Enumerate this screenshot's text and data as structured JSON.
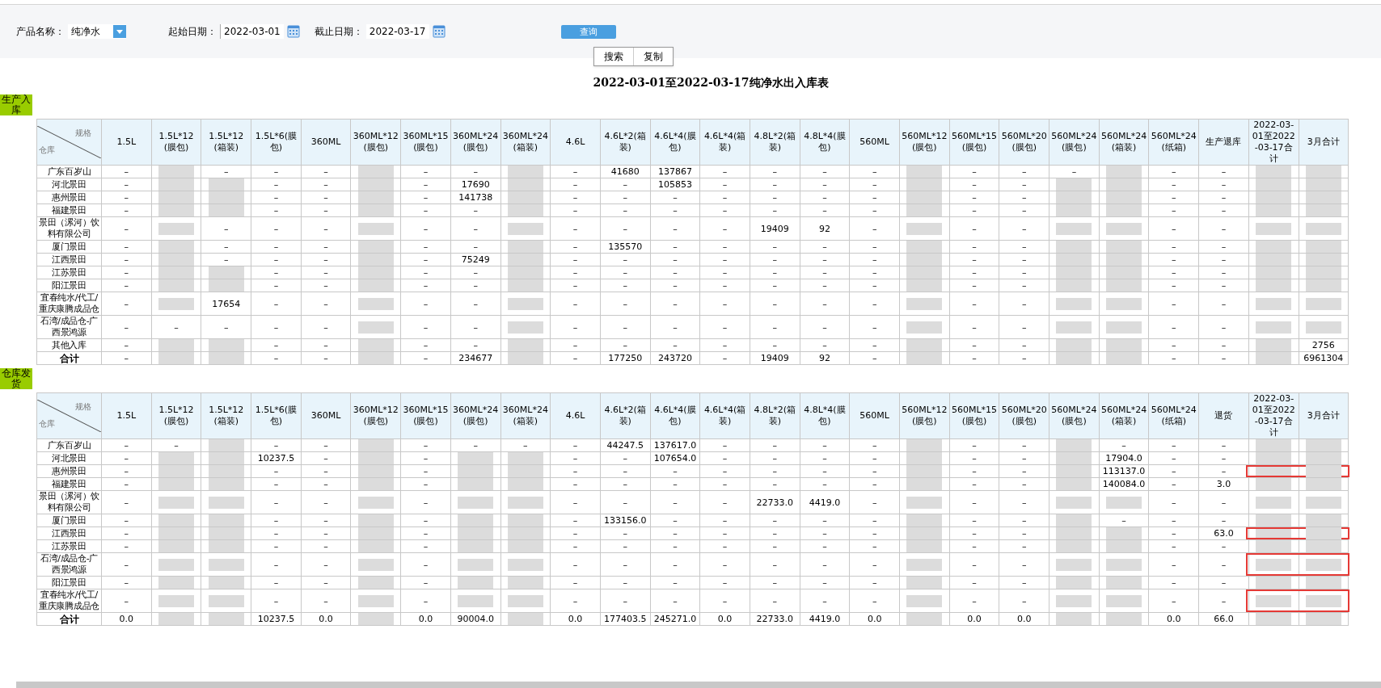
{
  "filters": {
    "product_label": "产品名称：",
    "product_value": "纯净水",
    "start_label": "起始日期：",
    "start_value": "2022-03-01",
    "end_label": "截止日期：",
    "end_value": "2022-03-17",
    "query_button": "查询"
  },
  "toolbar": [
    "搜索",
    "复制"
  ],
  "report_title": "2022-03-01至2022-03-17纯净水出入库表",
  "sections": [
    {
      "tag": "生产入库",
      "corner_top": "规格",
      "corner_bottom": "仓库",
      "columns": [
        "1.5L",
        "1.5L*12(膜包)",
        "1.5L*12(箱装)",
        "1.5L*6(膜包)",
        "360ML",
        "360ML*12(膜包)",
        "360ML*15(膜包)",
        "360ML*24(膜包)",
        "360ML*24(箱装)",
        "4.6L",
        "4.6L*2(箱装)",
        "4.6L*4(膜包)",
        "4.6L*4(箱装)",
        "4.8L*2(箱装)",
        "4.8L*4(膜包)",
        "560ML",
        "560ML*12(膜包)",
        "560ML*15(膜包)",
        "560ML*20(膜包)",
        "560ML*24(膜包)",
        "560ML*24(箱装)",
        "560ML*24(纸箱)",
        "生产退库",
        "2022-03-01至2022-03-17合计",
        "3月合计"
      ],
      "rows": [
        {
          "name": "广东百岁山",
          "kind": "item",
          "flagged": false,
          "cells": [
            "–",
            null,
            "–",
            "–",
            "–",
            null,
            "–",
            "–",
            null,
            "–",
            "41680",
            "137867",
            "–",
            "–",
            "–",
            "–",
            null,
            "–",
            "–",
            "–",
            null,
            "–",
            "–",
            null,
            null
          ]
        },
        {
          "name": "河北景田",
          "kind": "item",
          "flagged": false,
          "cells": [
            "–",
            null,
            null,
            "–",
            "–",
            null,
            "–",
            "17690",
            null,
            "–",
            "–",
            "105853",
            "–",
            "–",
            "–",
            "–",
            null,
            "–",
            "–",
            null,
            null,
            "–",
            "–",
            null,
            null
          ]
        },
        {
          "name": "惠州景田",
          "kind": "item",
          "flagged": false,
          "cells": [
            "–",
            null,
            null,
            "–",
            "–",
            null,
            "–",
            "141738",
            null,
            "–",
            "–",
            "–",
            "–",
            "–",
            "–",
            "–",
            null,
            "–",
            "–",
            null,
            null,
            "–",
            "–",
            null,
            null
          ]
        },
        {
          "name": "福建景田",
          "kind": "item",
          "flagged": false,
          "cells": [
            "–",
            null,
            null,
            "–",
            "–",
            null,
            "–",
            "–",
            null,
            "–",
            "–",
            "–",
            "–",
            "–",
            "–",
            "–",
            null,
            "–",
            "–",
            null,
            null,
            "–",
            "–",
            null,
            null
          ]
        },
        {
          "name": "景田（漯河）饮料有限公司",
          "kind": "item",
          "flagged": false,
          "cells": [
            "–",
            null,
            "–",
            "–",
            "–",
            null,
            "–",
            "–",
            null,
            "–",
            "–",
            "–",
            "–",
            "19409",
            "92",
            "–",
            null,
            "–",
            "–",
            null,
            null,
            "–",
            "–",
            null,
            null
          ]
        },
        {
          "name": "厦门景田",
          "kind": "item",
          "flagged": false,
          "cells": [
            "–",
            null,
            "–",
            "–",
            "–",
            null,
            "–",
            "–",
            null,
            "–",
            "135570",
            "–",
            "–",
            "–",
            "–",
            "–",
            null,
            "–",
            "–",
            null,
            null,
            "–",
            "–",
            null,
            null
          ]
        },
        {
          "name": "江西景田",
          "kind": "item",
          "flagged": false,
          "cells": [
            "–",
            null,
            "–",
            "–",
            "–",
            null,
            "–",
            "75249",
            null,
            "–",
            "–",
            "–",
            "–",
            "–",
            "–",
            "–",
            null,
            "–",
            "–",
            null,
            null,
            "–",
            "–",
            null,
            null
          ]
        },
        {
          "name": "江苏景田",
          "kind": "item",
          "flagged": false,
          "cells": [
            "–",
            null,
            null,
            "–",
            "–",
            null,
            "–",
            "–",
            null,
            "–",
            "–",
            "–",
            "–",
            "–",
            "–",
            "–",
            null,
            "–",
            "–",
            null,
            null,
            "–",
            "–",
            null,
            null
          ]
        },
        {
          "name": "阳江景田",
          "kind": "item",
          "flagged": false,
          "cells": [
            "–",
            null,
            null,
            "–",
            "–",
            null,
            "–",
            "–",
            null,
            "–",
            "–",
            "–",
            "–",
            "–",
            "–",
            "–",
            null,
            "–",
            "–",
            null,
            null,
            "–",
            "–",
            null,
            null
          ]
        },
        {
          "name": "宜春纯水/代工/重庆康腾成品仓",
          "kind": "item",
          "flagged": false,
          "cells": [
            "–",
            null,
            "17654",
            "–",
            "–",
            null,
            "–",
            "–",
            null,
            "–",
            "–",
            "–",
            "–",
            "–",
            "–",
            "–",
            null,
            "–",
            "–",
            null,
            null,
            "–",
            "–",
            null,
            null
          ]
        },
        {
          "name": "石湾/成品仓-广西景鸿源",
          "kind": "item",
          "flagged": false,
          "cells": [
            "–",
            "–",
            "–",
            "–",
            "–",
            null,
            "–",
            "–",
            null,
            "–",
            "–",
            "–",
            "–",
            "–",
            "–",
            "–",
            null,
            "–",
            "–",
            null,
            null,
            "–",
            "–",
            null,
            null
          ]
        },
        {
          "name": "其他入库",
          "kind": "item",
          "flagged": false,
          "cells": [
            "–",
            null,
            null,
            "–",
            "–",
            null,
            "–",
            "–",
            null,
            "–",
            "–",
            "–",
            "–",
            "–",
            "–",
            "–",
            null,
            "–",
            "–",
            null,
            null,
            "–",
            "–",
            null,
            "2756"
          ]
        },
        {
          "name": "合计",
          "kind": "total",
          "flagged": false,
          "cells": [
            "–",
            null,
            null,
            "–",
            "–",
            null,
            "–",
            "234677",
            null,
            "–",
            "177250",
            "243720",
            "–",
            "19409",
            "92",
            "–",
            null,
            "–",
            "–",
            null,
            null,
            "–",
            "–",
            null,
            "6961304"
          ]
        }
      ]
    },
    {
      "tag": "仓库发货",
      "corner_top": "规格",
      "corner_bottom": "仓库",
      "columns": [
        "1.5L",
        "1.5L*12(膜包)",
        "1.5L*12(箱装)",
        "1.5L*6(膜包)",
        "360ML",
        "360ML*12(膜包)",
        "360ML*15(膜包)",
        "360ML*24(膜包)",
        "360ML*24(箱装)",
        "4.6L",
        "4.6L*2(箱装)",
        "4.6L*4(膜包)",
        "4.6L*4(箱装)",
        "4.8L*2(箱装)",
        "4.8L*4(膜包)",
        "560ML",
        "560ML*12(膜包)",
        "560ML*15(膜包)",
        "560ML*20(膜包)",
        "560ML*24(膜包)",
        "560ML*24(箱装)",
        "560ML*24(纸箱)",
        "退货",
        "2022-03-01至2022-03-17合计",
        "3月合计"
      ],
      "rows": [
        {
          "name": "广东百岁山",
          "kind": "item",
          "flagged": false,
          "cells": [
            "–",
            "–",
            null,
            "–",
            "–",
            null,
            "–",
            "–",
            "–",
            "–",
            "44247.5",
            "137617.0",
            "–",
            "–",
            "–",
            "–",
            null,
            "–",
            "–",
            null,
            "–",
            "–",
            "–",
            null,
            null
          ]
        },
        {
          "name": "河北景田",
          "kind": "item",
          "flagged": false,
          "cells": [
            "–",
            null,
            null,
            "10237.5",
            "–",
            null,
            "–",
            null,
            null,
            "–",
            "–",
            "107654.0",
            "–",
            "–",
            "–",
            "–",
            null,
            "–",
            "–",
            null,
            "17904.0",
            "–",
            "–",
            null,
            null
          ]
        },
        {
          "name": "惠州景田",
          "kind": "item",
          "flagged": true,
          "cells": [
            "–",
            null,
            null,
            "–",
            "–",
            null,
            "–",
            null,
            null,
            "–",
            "–",
            "–",
            "–",
            "–",
            "–",
            "–",
            null,
            "–",
            "–",
            null,
            "113137.0",
            "–",
            "–",
            null,
            null
          ]
        },
        {
          "name": "福建景田",
          "kind": "item",
          "flagged": false,
          "cells": [
            "–",
            null,
            null,
            "–",
            "–",
            null,
            "–",
            null,
            null,
            "–",
            "–",
            "–",
            "–",
            "–",
            "–",
            "–",
            null,
            "–",
            "–",
            null,
            "140084.0",
            "–",
            "3.0",
            null,
            null
          ]
        },
        {
          "name": "景田（漯河）饮料有限公司",
          "kind": "item",
          "flagged": false,
          "cells": [
            "–",
            null,
            null,
            "–",
            "–",
            null,
            "–",
            null,
            null,
            "–",
            "–",
            "–",
            "–",
            "22733.0",
            "4419.0",
            "–",
            null,
            "–",
            "–",
            null,
            null,
            "–",
            "–",
            null,
            null
          ]
        },
        {
          "name": "厦门景田",
          "kind": "item",
          "flagged": false,
          "cells": [
            "–",
            null,
            null,
            "–",
            "–",
            null,
            "–",
            null,
            null,
            "–",
            "133156.0",
            "–",
            "–",
            "–",
            "–",
            "–",
            null,
            "–",
            "–",
            null,
            "–",
            "–",
            "–",
            null,
            null
          ]
        },
        {
          "name": "江西景田",
          "kind": "item",
          "flagged": true,
          "cells": [
            "–",
            null,
            null,
            "–",
            "–",
            null,
            "–",
            null,
            null,
            "–",
            "–",
            "–",
            "–",
            "–",
            "–",
            "–",
            null,
            "–",
            "–",
            null,
            null,
            "–",
            "63.0",
            null,
            null
          ]
        },
        {
          "name": "江苏景田",
          "kind": "item",
          "flagged": false,
          "cells": [
            "–",
            null,
            null,
            "–",
            "–",
            null,
            "–",
            null,
            null,
            "–",
            "–",
            "–",
            "–",
            "–",
            "–",
            "–",
            null,
            "–",
            "–",
            null,
            null,
            "–",
            "–",
            null,
            null
          ]
        },
        {
          "name": "石湾/成品仓-广西景鸿源",
          "kind": "item",
          "flagged": true,
          "cells": [
            "–",
            null,
            null,
            "–",
            "–",
            null,
            "–",
            null,
            null,
            "–",
            "–",
            "–",
            "–",
            "–",
            "–",
            "–",
            null,
            "–",
            "–",
            null,
            null,
            "–",
            "–",
            null,
            null
          ]
        },
        {
          "name": "阳江景田",
          "kind": "item",
          "flagged": false,
          "cells": [
            "–",
            null,
            null,
            "–",
            "–",
            null,
            "–",
            null,
            null,
            "–",
            "–",
            "–",
            "–",
            "–",
            "–",
            "–",
            null,
            "–",
            "–",
            null,
            null,
            "–",
            "–",
            null,
            null
          ]
        },
        {
          "name": "宜春纯水/代工/重庆康腾成品仓",
          "kind": "item",
          "flagged": true,
          "cells": [
            "–",
            null,
            null,
            "–",
            "–",
            null,
            "–",
            null,
            null,
            "–",
            "–",
            "–",
            "–",
            "–",
            "–",
            "–",
            null,
            "–",
            "–",
            null,
            null,
            "–",
            "–",
            null,
            null
          ]
        },
        {
          "name": "合计",
          "kind": "total",
          "flagged": false,
          "cells": [
            "0.0",
            null,
            null,
            "10237.5",
            "0.0",
            null,
            "0.0",
            "90004.0",
            null,
            "0.0",
            "177403.5",
            "245271.0",
            "0.0",
            "22733.0",
            "4419.0",
            "0.0",
            null,
            "0.0",
            "0.0",
            null,
            null,
            "0.0",
            "66.0",
            null,
            null
          ]
        }
      ]
    }
  ]
}
